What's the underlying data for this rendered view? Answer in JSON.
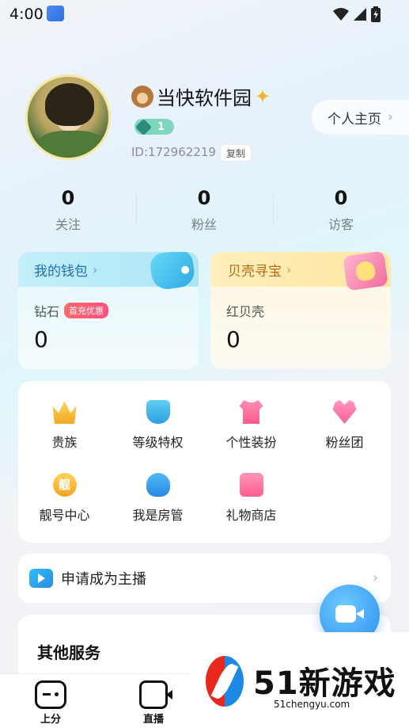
{
  "status_bar": {
    "time": "4:00"
  },
  "profile": {
    "username": "当快软件园",
    "level": "1",
    "id_text": "ID:172962219",
    "copy_label": "复制",
    "homepage_label": "个人主页"
  },
  "stats": [
    {
      "value": "0",
      "label": "关注"
    },
    {
      "value": "0",
      "label": "粉丝"
    },
    {
      "value": "0",
      "label": "访客"
    }
  ],
  "wallet": {
    "title": "我的钱包",
    "diamond_label": "钻石",
    "promo_badge": "首充优惠",
    "diamond_value": "0"
  },
  "treasure": {
    "title": "贝壳寻宝",
    "shell_label": "红贝壳",
    "shell_value": "0"
  },
  "features": [
    {
      "label": "贵族",
      "icon": "crown-icon"
    },
    {
      "label": "等级特权",
      "icon": "shield-icon"
    },
    {
      "label": "个性装扮",
      "icon": "shirt-icon"
    },
    {
      "label": "粉丝团",
      "icon": "heart-icon"
    },
    {
      "label": "靓号中心",
      "icon": "liang-icon",
      "icon_text": "靓"
    },
    {
      "label": "我是房管",
      "icon": "admin-icon"
    },
    {
      "label": "礼物商店",
      "icon": "gift-icon"
    }
  ],
  "apply": {
    "label": "申请成为主播"
  },
  "services": {
    "title": "其他服务"
  },
  "tabs": [
    {
      "label": "上分",
      "icon": "gamepad-icon"
    },
    {
      "label": "直播",
      "icon": "live-icon"
    }
  ],
  "watermark": {
    "title": "51新游戏",
    "subtitle": "51chengyu.com"
  },
  "colors": {
    "wallet_accent": "#1f6fbe",
    "treasure_accent": "#b66a16",
    "promo_badge": "#ff4f83",
    "live_button": "#3fa0f4"
  }
}
